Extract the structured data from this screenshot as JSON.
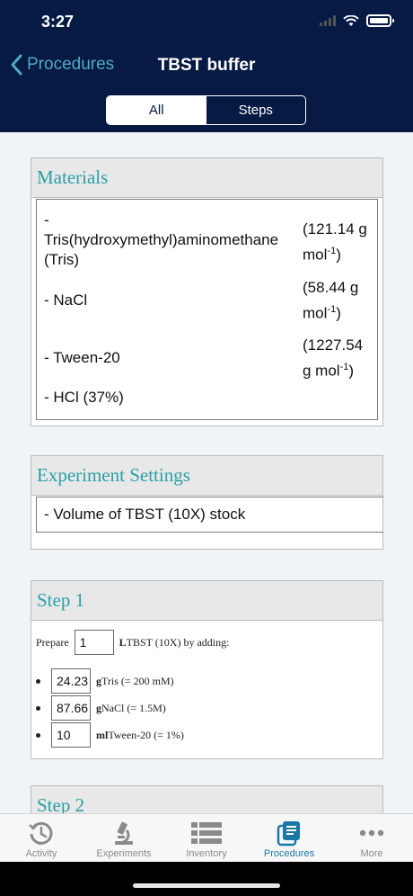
{
  "status": {
    "time": "3:27"
  },
  "nav": {
    "back_label": "Procedures",
    "title": "TBST buffer"
  },
  "segments": [
    {
      "label": "All",
      "active": true
    },
    {
      "label": "Steps",
      "active": false
    }
  ],
  "materials": {
    "title": "Materials",
    "items": [
      {
        "name_line1": "-",
        "name_line2": "Tris(hydroxymethyl)aminomethane",
        "name_line3": "(Tris)",
        "value_line1": "(121.14 g",
        "value_line2_pre": "mol",
        "value_sup": "-1",
        "value_line2_post": ")"
      },
      {
        "name": "- NaCl",
        "value_line1": "(58.44 g",
        "value_line2_pre": "mol",
        "value_sup": "-1",
        "value_line2_post": ")"
      },
      {
        "name": "- Tween-20",
        "value_line1": "(1227.54",
        "value_line2_pre": "g mol",
        "value_sup": "-1",
        "value_line2_post": ")"
      },
      {
        "name": "- HCl (37%)"
      }
    ]
  },
  "settings": {
    "title": "Experiment Settings",
    "item": "- Volume of TBST (10X) stock"
  },
  "step1": {
    "title": "Step 1",
    "prepare_label": "Prepare",
    "volume_value": "1",
    "volume_unit": "L",
    "volume_text": "TBST (10X) by adding:",
    "ingredients": [
      {
        "value": "24.23",
        "unit": "g",
        "text": "Tris (= 200 mM)"
      },
      {
        "value": "87.66",
        "unit": "g",
        "text": "NaCl (= 1.5M)"
      },
      {
        "value": "10",
        "unit": "ml",
        "text": "Tween-20 (= 1%)"
      }
    ]
  },
  "step2": {
    "title": "Step 2"
  },
  "tabs": [
    {
      "label": "Activity",
      "icon": "clock-icon",
      "active": false
    },
    {
      "label": "Experiments",
      "icon": "microscope-icon",
      "active": false
    },
    {
      "label": "Inventory",
      "icon": "list-icon",
      "active": false
    },
    {
      "label": "Procedures",
      "icon": "procedures-icon",
      "active": true
    },
    {
      "label": "More",
      "icon": "more-icon",
      "active": false
    }
  ],
  "colors": {
    "header": "#071a43",
    "accent": "#2aa0a8",
    "active_tab": "#1a78a6"
  }
}
